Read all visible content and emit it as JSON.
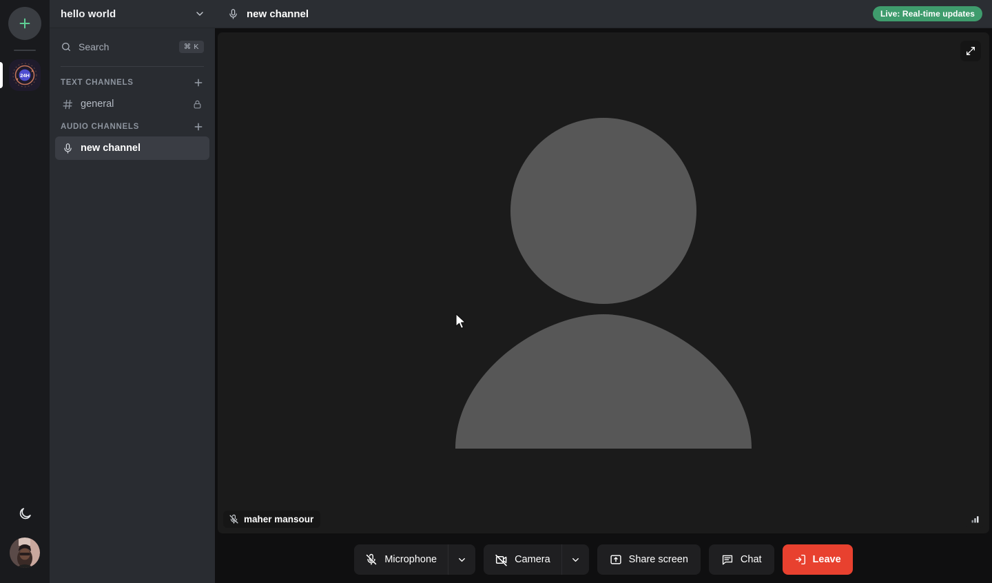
{
  "rail": {
    "add_server": {
      "name": "add-server-button",
      "icon": "plus-icon"
    },
    "servers": [
      {
        "name": "hello world",
        "badge_text": "24H",
        "active": true,
        "icon": "server-icon-24h"
      }
    ],
    "theme_toggle": {
      "label": "Dark mode",
      "icon": "moon-icon"
    },
    "user_avatar": {
      "label": "User avatar",
      "icon": "avatar"
    }
  },
  "sidebar": {
    "server_name": "hello world",
    "server_menu_icon": "chevron-down-icon",
    "search": {
      "label": "Search",
      "placeholder": "Search",
      "shortcut": "⌘ K",
      "icon": "search-icon"
    },
    "groups": [
      {
        "title": "TEXT CHANNELS",
        "add_icon": "plus-icon",
        "channels": [
          {
            "name": "general",
            "icon": "hash-icon",
            "trailing_icon": "lock-icon",
            "active": false
          }
        ]
      },
      {
        "title": "AUDIO CHANNELS",
        "add_icon": "plus-icon",
        "channels": [
          {
            "name": "new channel",
            "icon": "microphone-icon",
            "trailing_icon": "",
            "active": true
          }
        ]
      }
    ]
  },
  "topbar": {
    "channel_icon": "microphone-icon",
    "channel_name": "new channel",
    "live_badge": "Live: Real-time updates",
    "live_badge_color": "#3f9c6d"
  },
  "stage": {
    "expand_icon": "fullscreen-expand-icon",
    "signal_icon": "signal-bars-icon",
    "participant": {
      "name": "maher mansour",
      "mic_icon": "microphone-muted-icon",
      "video_state": "camera-off",
      "placeholder_color": "#575757",
      "tile_background": "#1b1b1b"
    }
  },
  "controls": {
    "microphone": {
      "label": "Microphone",
      "icon": "microphone-muted-icon",
      "caret_icon": "chevron-down-icon",
      "muted": true
    },
    "camera": {
      "label": "Camera",
      "icon": "camera-off-icon",
      "caret_icon": "chevron-down-icon",
      "muted": true
    },
    "share_screen": {
      "label": "Share screen",
      "icon": "share-screen-icon"
    },
    "chat": {
      "label": "Chat",
      "icon": "chat-bubble-icon"
    },
    "leave": {
      "label": "Leave",
      "icon": "leave-arrow-icon",
      "color": "#e8412f"
    }
  }
}
